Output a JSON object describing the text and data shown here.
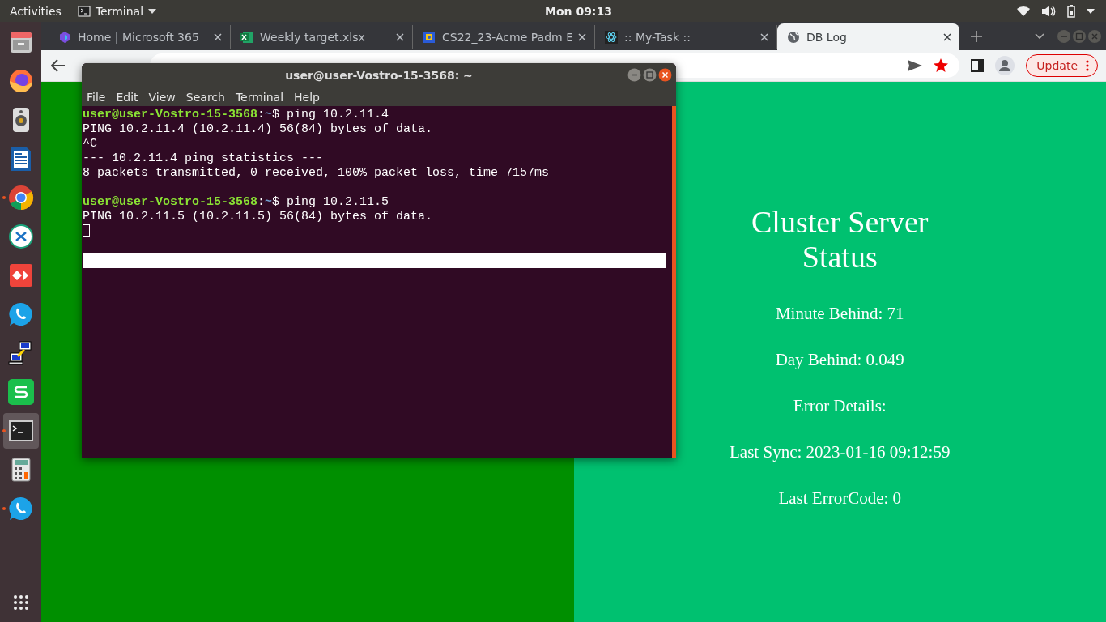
{
  "top_bar": {
    "activities": "Activities",
    "app_menu": "Terminal",
    "clock": "Mon 09:13"
  },
  "dock": [
    {
      "kind": "files",
      "running": false,
      "selected": false
    },
    {
      "kind": "firefox",
      "running": false,
      "selected": false
    },
    {
      "kind": "speaker",
      "running": false,
      "selected": false
    },
    {
      "kind": "writer",
      "running": false,
      "selected": false
    },
    {
      "kind": "chrome",
      "running": true,
      "selected": false
    },
    {
      "kind": "remote",
      "running": false,
      "selected": false
    },
    {
      "kind": "anydesk",
      "running": false,
      "selected": false
    },
    {
      "kind": "phone",
      "running": false,
      "selected": false
    },
    {
      "kind": "network",
      "running": false,
      "selected": false
    },
    {
      "kind": "sheet",
      "running": false,
      "selected": false
    },
    {
      "kind": "terminal",
      "running": true,
      "selected": true
    },
    {
      "kind": "calculator",
      "running": false,
      "selected": false
    },
    {
      "kind": "phone",
      "running": true,
      "selected": false
    }
  ],
  "browser": {
    "tabs": [
      {
        "title": "Home | Microsoft 365",
        "selected": false
      },
      {
        "title": "Weekly target.xlsx",
        "selected": false
      },
      {
        "title": "CS22_23-Acme Padm E",
        "selected": false
      },
      {
        "title": ":: My-Task ::",
        "selected": false
      },
      {
        "title": "DB Log",
        "selected": true
      }
    ],
    "update_button": "Update"
  },
  "terminal": {
    "title": "user@user-Vostro-15-3568: ~",
    "menu": [
      "File",
      "Edit",
      "View",
      "Search",
      "Terminal",
      "Help"
    ],
    "lines": [
      {
        "kind": "prompt",
        "user": "user@user-Vostro-15-3568",
        "sep": ":",
        "path": "~",
        "symbol": "$",
        "command": "ping 10.2.11.4"
      },
      {
        "kind": "output",
        "text": "PING 10.2.11.4 (10.2.11.4) 56(84) bytes of data."
      },
      {
        "kind": "output",
        "text": "^C"
      },
      {
        "kind": "output",
        "text": "--- 10.2.11.4 ping statistics ---"
      },
      {
        "kind": "output",
        "text": "8 packets transmitted, 0 received, 100% packet loss, time 7157ms"
      },
      {
        "kind": "blank"
      },
      {
        "kind": "prompt",
        "user": "user@user-Vostro-15-3568",
        "sep": ":",
        "path": "~",
        "symbol": "$",
        "command": "ping 10.2.11.5"
      },
      {
        "kind": "output",
        "text": "PING 10.2.11.5 (10.2.11.5) 56(84) bytes of data."
      },
      {
        "kind": "cursor"
      },
      {
        "kind": "blank"
      },
      {
        "kind": "bar"
      }
    ]
  },
  "page": {
    "title": "Cluster Server Status",
    "lines": [
      "Minute Behind: 71",
      "Day Behind: 0.049",
      "Error Details:",
      "Last Sync: 2023-01-16 09:12:59",
      "Last ErrorCode: 0"
    ]
  }
}
